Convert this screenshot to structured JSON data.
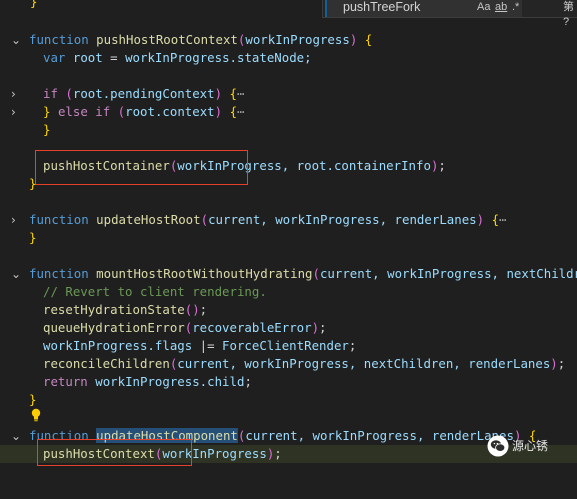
{
  "find_widget": {
    "query": "pushTreeFork",
    "match_case_label": "Aa",
    "whole_word_label": "ab",
    "regex_label": ".*",
    "result_text": "第 ?"
  },
  "code": {
    "l0_brace": "}",
    "fn1_kw": "function",
    "fn1_name": "pushHostRootContext",
    "fn1_param": "workInProgress",
    "fn1_body_var_kw": "var",
    "fn1_body_var": "root",
    "fn1_body_rhs": "workInProgress.stateNode;",
    "fn1_if": "if",
    "fn1_if_cond": "root.pendingContext",
    "fn1_else": "else",
    "fn1_elseif": "if",
    "fn1_elseif_cond": "root.context",
    "fn1_call": "pushHostContainer",
    "fn1_call_args": "workInProgress, root.containerInfo",
    "fn2_kw": "function",
    "fn2_name": "updateHostRoot",
    "fn2_params": "current, workInProgress, renderLanes",
    "fn3_kw": "function",
    "fn3_name": "mountHostRootWithoutHydrating",
    "fn3_params": "current, workInProgress, nextChildren",
    "fn3_comment": "// Revert to client rendering.",
    "fn3_l1": "resetHydrationState",
    "fn3_l2": "queueHydrationError",
    "fn3_l2_arg": "recoverableError",
    "fn3_l3_lhs": "workInProgress.flags",
    "fn3_l3_op": " |= ",
    "fn3_l3_rhs": "ForceClientRender",
    "fn3_l4": "reconcileChildren",
    "fn3_l4_args": "current, workInProgress, nextChildren, renderLanes",
    "fn3_ret_kw": "return",
    "fn3_ret": "workInProgress.child",
    "fn4_kw": "function",
    "fn4_name": "updateHostComponent",
    "fn4_params": "current, workInProgress, renderLanes",
    "fn4_call": "pushHostContext",
    "fn4_call_arg": "workInProgress",
    "ellipsis": "⋯"
  },
  "watermark": {
    "text": "源心锈"
  }
}
